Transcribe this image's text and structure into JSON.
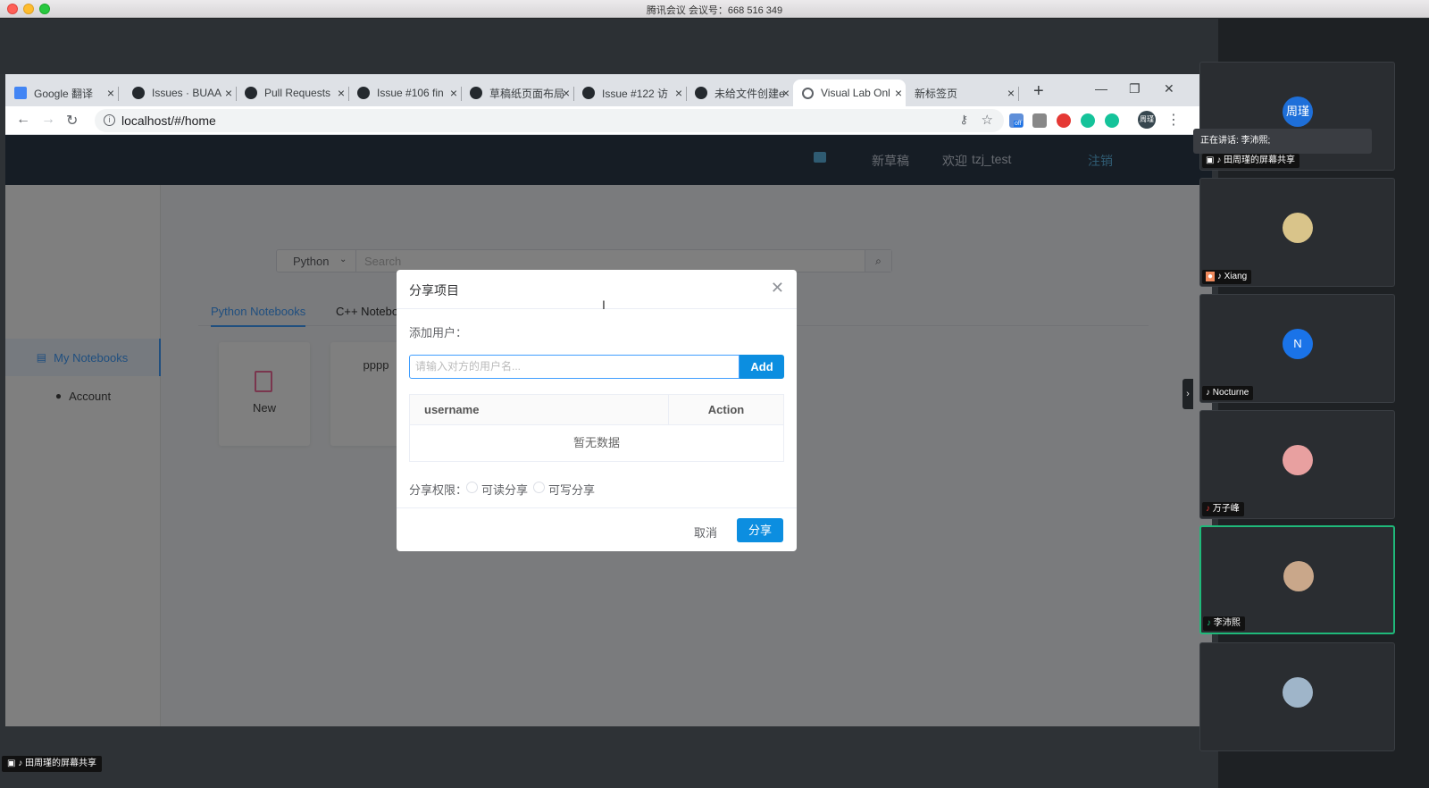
{
  "mac": {
    "title": "腾讯会议 会议号：668 516 349"
  },
  "browser": {
    "tabs": [
      {
        "label": "Google 翻译"
      },
      {
        "label": "Issues · BUAA"
      },
      {
        "label": "Pull Requests"
      },
      {
        "label": "Issue #106 fin"
      },
      {
        "label": "草稿纸页面布局"
      },
      {
        "label": "Issue #122 访"
      },
      {
        "label": "未给文件创建e"
      },
      {
        "label": "Visual Lab Onl"
      },
      {
        "label": "新标签页"
      }
    ],
    "url": "localhost/#/home",
    "profile": "周瑾",
    "ext_badge": "off"
  },
  "app": {
    "header": {
      "new_draft": "新草稿",
      "welcome": "欢迎",
      "username": "tzj_test",
      "logout": "注销"
    },
    "sidebar": [
      {
        "label": "My Notebooks"
      },
      {
        "label": "Account"
      }
    ],
    "search": {
      "language": "Python",
      "placeholder": "Search"
    },
    "tabs": [
      {
        "label": "Python Notebooks"
      },
      {
        "label": "C++ Notebooks"
      }
    ],
    "cards": [
      {
        "label": "New"
      },
      {
        "label": "pppp"
      }
    ]
  },
  "dialog": {
    "title": "分享项目",
    "add_user_label": "添加用户：",
    "input_placeholder": "请输入对方的用户名...",
    "add_button": "Add",
    "table": {
      "col_username": "username",
      "col_action": "Action",
      "empty_text": "暂无数据"
    },
    "permission_label": "分享权限：",
    "permissions": [
      {
        "label": "可读分享"
      },
      {
        "label": "可写分享"
      }
    ],
    "cancel": "取消",
    "share": "分享"
  },
  "meeting": {
    "speaking": "正在讲话: 李沛熙;",
    "participants": [
      {
        "name": "田周瑾的屏幕共享",
        "avatar": "周瑾",
        "color": "#1e6fd9"
      },
      {
        "name": "Xiang",
        "avatar": "",
        "color": "#d9c48a"
      },
      {
        "name": "Nocturne",
        "avatar": "N",
        "color": "#1a73e8"
      },
      {
        "name": "万子峰",
        "avatar": "",
        "color": "#e8a0a0"
      },
      {
        "name": "李沛熙",
        "avatar": "",
        "color": "#c9a78a"
      },
      {
        "name": "",
        "avatar": "",
        "color": "#9fb5c9"
      }
    ],
    "bottom_share_tag": "田周瑾的屏幕共享"
  }
}
